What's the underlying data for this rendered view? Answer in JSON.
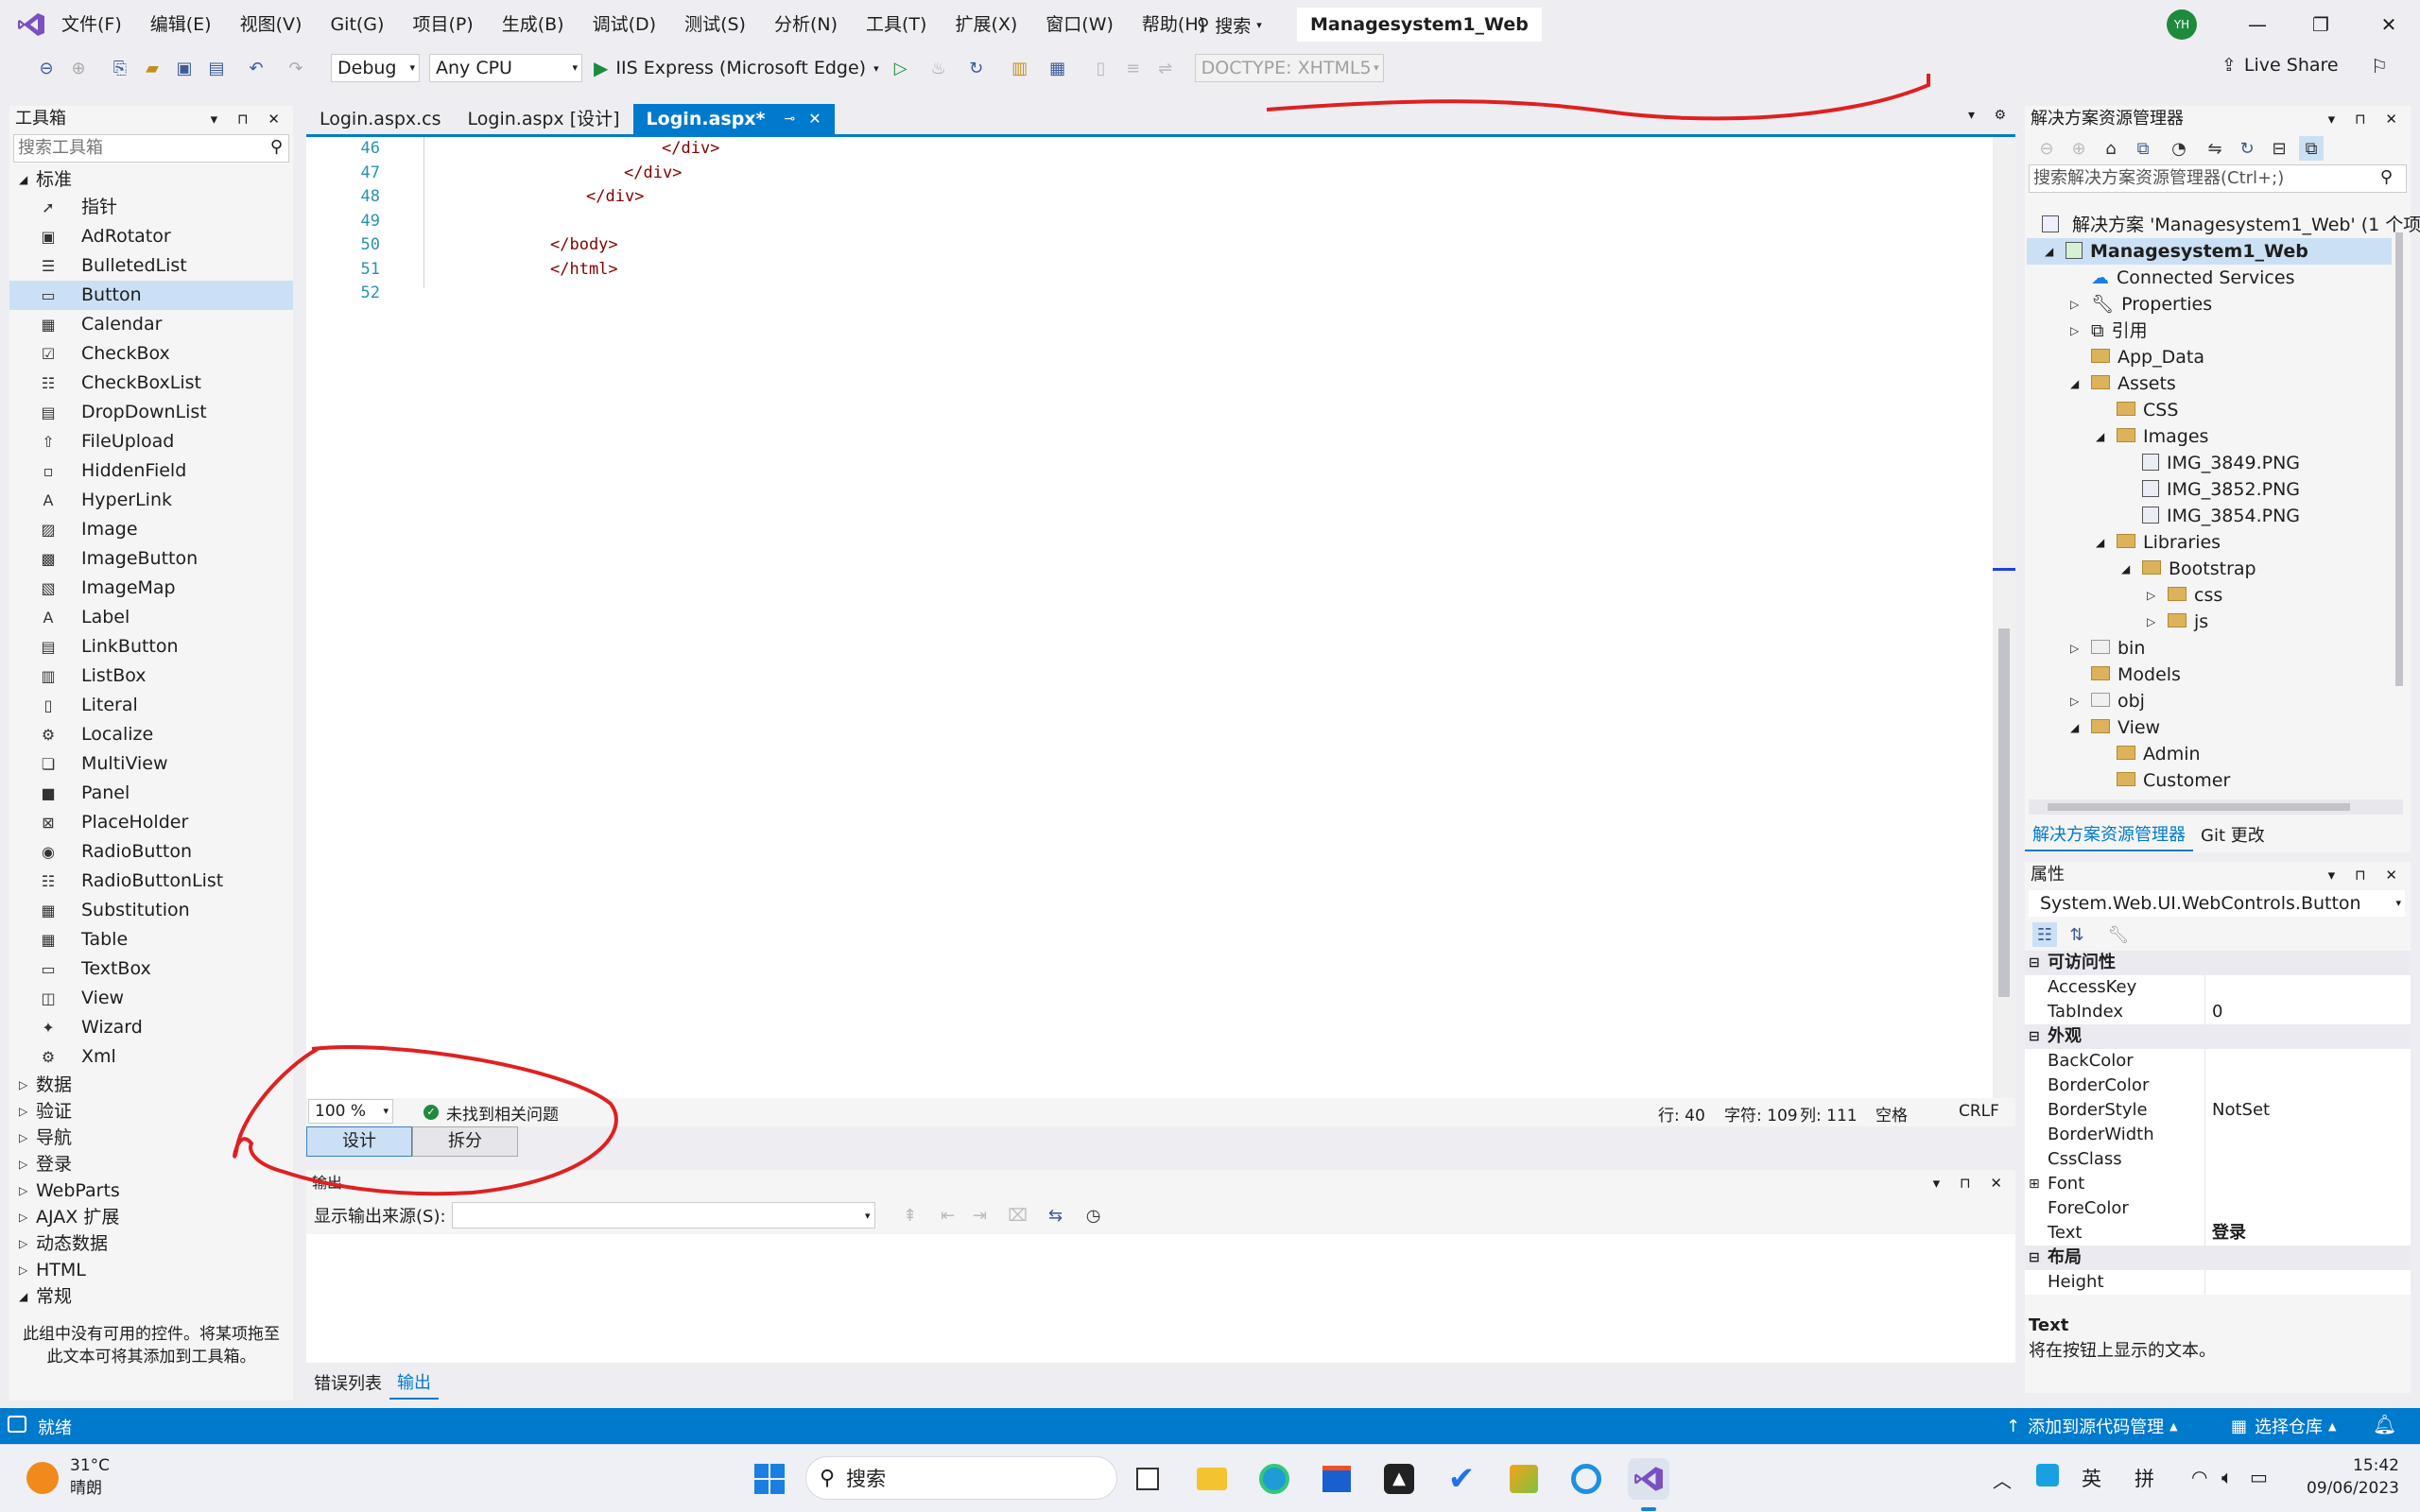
{
  "titlebar": {
    "menu": [
      "文件(F)",
      "编辑(E)",
      "视图(V)",
      "Git(G)",
      "项目(P)",
      "生成(B)",
      "调试(D)",
      "测试(S)",
      "分析(N)",
      "工具(T)",
      "扩展(X)",
      "窗口(W)",
      "帮助(H)"
    ],
    "search_label": "搜索",
    "solution_name": "Managesystem1_Web",
    "avatar_initials": "YH",
    "live_share": "Live Share"
  },
  "toolbar": {
    "config": "Debug",
    "platform": "Any CPU",
    "run_target": "IIS Express (Microsoft Edge)",
    "doctype": "DOCTYPE: XHTML5"
  },
  "toolbox": {
    "title": "工具箱",
    "search_placeholder": "搜索工具箱",
    "group_standard": "标准",
    "items": [
      {
        "label": "指针",
        "icon": "pointer-icon"
      },
      {
        "label": "AdRotator",
        "icon": "adrotator-icon"
      },
      {
        "label": "BulletedList",
        "icon": "bulletedlist-icon"
      },
      {
        "label": "Button",
        "icon": "button-icon",
        "selected": true
      },
      {
        "label": "Calendar",
        "icon": "calendar-icon"
      },
      {
        "label": "CheckBox",
        "icon": "checkbox-icon"
      },
      {
        "label": "CheckBoxList",
        "icon": "checkboxlist-icon"
      },
      {
        "label": "DropDownList",
        "icon": "dropdownlist-icon"
      },
      {
        "label": "FileUpload",
        "icon": "fileupload-icon"
      },
      {
        "label": "HiddenField",
        "icon": "hiddenfield-icon"
      },
      {
        "label": "HyperLink",
        "icon": "hyperlink-icon"
      },
      {
        "label": "Image",
        "icon": "image-icon"
      },
      {
        "label": "ImageButton",
        "icon": "imagebutton-icon"
      },
      {
        "label": "ImageMap",
        "icon": "imagemap-icon"
      },
      {
        "label": "Label",
        "icon": "label-icon"
      },
      {
        "label": "LinkButton",
        "icon": "linkbutton-icon"
      },
      {
        "label": "ListBox",
        "icon": "listbox-icon"
      },
      {
        "label": "Literal",
        "icon": "literal-icon"
      },
      {
        "label": "Localize",
        "icon": "localize-icon"
      },
      {
        "label": "MultiView",
        "icon": "multiview-icon"
      },
      {
        "label": "Panel",
        "icon": "panel-icon"
      },
      {
        "label": "PlaceHolder",
        "icon": "placeholder-icon"
      },
      {
        "label": "RadioButton",
        "icon": "radiobutton-icon"
      },
      {
        "label": "RadioButtonList",
        "icon": "radiobuttonlist-icon"
      },
      {
        "label": "Substitution",
        "icon": "substitution-icon"
      },
      {
        "label": "Table",
        "icon": "table-icon"
      },
      {
        "label": "TextBox",
        "icon": "textbox-icon"
      },
      {
        "label": "View",
        "icon": "view-icon"
      },
      {
        "label": "Wizard",
        "icon": "wizard-icon"
      },
      {
        "label": "Xml",
        "icon": "xml-icon"
      }
    ],
    "groups": [
      "数据",
      "验证",
      "导航",
      "登录",
      "WebParts",
      "AJAX 扩展",
      "动态数据",
      "HTML"
    ],
    "group_general": "常规",
    "empty_text": "此组中没有可用的控件。将某项拖至此文本可将其添加到工具箱。"
  },
  "editor": {
    "tabs": [
      {
        "label": "Login.aspx.cs",
        "active": false
      },
      {
        "label": "Login.aspx [设计]",
        "active": false
      },
      {
        "label": "Login.aspx*",
        "active": true
      }
    ],
    "lines": [
      {
        "num": "46",
        "text": "</div>"
      },
      {
        "num": "47",
        "text": "</div>"
      },
      {
        "num": "48",
        "text": "</div>"
      },
      {
        "num": "49",
        "text": ""
      },
      {
        "num": "50",
        "text": "</body>"
      },
      {
        "num": "51",
        "text": "</html>"
      },
      {
        "num": "52",
        "text": ""
      }
    ],
    "zoom": "100 %",
    "issues": "未找到相关问题",
    "cursor_line": "行: 40",
    "cursor_char": "字符: 109",
    "cursor_col": "列: 111",
    "whitespace": "空格",
    "line_ending": "CRLF",
    "view_design": "设计",
    "view_split": "拆分"
  },
  "output": {
    "title": "输出",
    "source_label": "显示输出来源(S):",
    "bottom_tabs": [
      "错误列表",
      "输出"
    ]
  },
  "solution_explorer": {
    "title": "解决方案资源管理器",
    "search_placeholder": "搜索解决方案资源管理器(Ctrl+;)",
    "solution_line": "解决方案 'Managesystem1_Web' (1 个项目",
    "tree": [
      {
        "label": "Managesystem1_Web",
        "level": 1,
        "expander": "open",
        "kind": "project",
        "selected": true
      },
      {
        "label": "Connected Services",
        "level": 2,
        "expander": "none",
        "kind": "service"
      },
      {
        "label": "Properties",
        "level": 2,
        "expander": "closed",
        "kind": "wrench"
      },
      {
        "label": "引用",
        "level": 2,
        "expander": "closed",
        "kind": "ref"
      },
      {
        "label": "App_Data",
        "level": 2,
        "expander": "none",
        "kind": "folder"
      },
      {
        "label": "Assets",
        "level": 2,
        "expander": "open",
        "kind": "folder"
      },
      {
        "label": "CSS",
        "level": 3,
        "expander": "none",
        "kind": "folder"
      },
      {
        "label": "Images",
        "level": 3,
        "expander": "open",
        "kind": "folder"
      },
      {
        "label": "IMG_3849.PNG",
        "level": 4,
        "expander": "none",
        "kind": "image"
      },
      {
        "label": "IMG_3852.PNG",
        "level": 4,
        "expander": "none",
        "kind": "image"
      },
      {
        "label": "IMG_3854.PNG",
        "level": 4,
        "expander": "none",
        "kind": "image"
      },
      {
        "label": "Libraries",
        "level": 3,
        "expander": "open",
        "kind": "folder"
      },
      {
        "label": "Bootstrap",
        "level": 4,
        "expander": "open",
        "kind": "folder"
      },
      {
        "label": "css",
        "level": 5,
        "expander": "closed",
        "kind": "folder"
      },
      {
        "label": "js",
        "level": 5,
        "expander": "closed",
        "kind": "folder"
      },
      {
        "label": "bin",
        "level": 2,
        "expander": "closed",
        "kind": "folder-grey"
      },
      {
        "label": "Models",
        "level": 2,
        "expander": "none",
        "kind": "folder"
      },
      {
        "label": "obj",
        "level": 2,
        "expander": "closed",
        "kind": "folder-grey"
      },
      {
        "label": "View",
        "level": 2,
        "expander": "open",
        "kind": "folder"
      },
      {
        "label": "Admin",
        "level": 3,
        "expander": "none",
        "kind": "folder"
      },
      {
        "label": "Customer",
        "level": 3,
        "expander": "none",
        "kind": "folder"
      }
    ],
    "tabs": [
      "解决方案资源管理器",
      "Git 更改"
    ]
  },
  "properties": {
    "title": "属性",
    "object": "System.Web.UI.WebControls.Button",
    "rows": [
      {
        "key": "可访问性",
        "value": "",
        "cat": true
      },
      {
        "key": "AccessKey",
        "value": ""
      },
      {
        "key": "TabIndex",
        "value": "0"
      },
      {
        "key": "外观",
        "value": "",
        "cat": true
      },
      {
        "key": "BackColor",
        "value": ""
      },
      {
        "key": "BorderColor",
        "value": ""
      },
      {
        "key": "BorderStyle",
        "value": "NotSet"
      },
      {
        "key": "BorderWidth",
        "value": ""
      },
      {
        "key": "CssClass",
        "value": ""
      },
      {
        "key": "Font",
        "value": "",
        "expandable": true
      },
      {
        "key": "ForeColor",
        "value": ""
      },
      {
        "key": "Text",
        "value": "登录",
        "bold": true
      },
      {
        "key": "布局",
        "value": "",
        "cat": true
      },
      {
        "key": "Height",
        "value": ""
      }
    ],
    "desc_title": "Text",
    "desc_text": "将在按钮上显示的文本。"
  },
  "statusbar": {
    "ready": "就绪",
    "add_source": "添加到源代码管理",
    "select_repo": "选择仓库"
  },
  "taskbar": {
    "temperature": "31°C",
    "weather": "晴朗",
    "search": "搜索",
    "ime_lang": "英",
    "ime_mode": "拼",
    "time": "15:42",
    "date": "09/06/2023"
  },
  "colors": {
    "accent": "#007acc",
    "annotation": "#e02020"
  }
}
